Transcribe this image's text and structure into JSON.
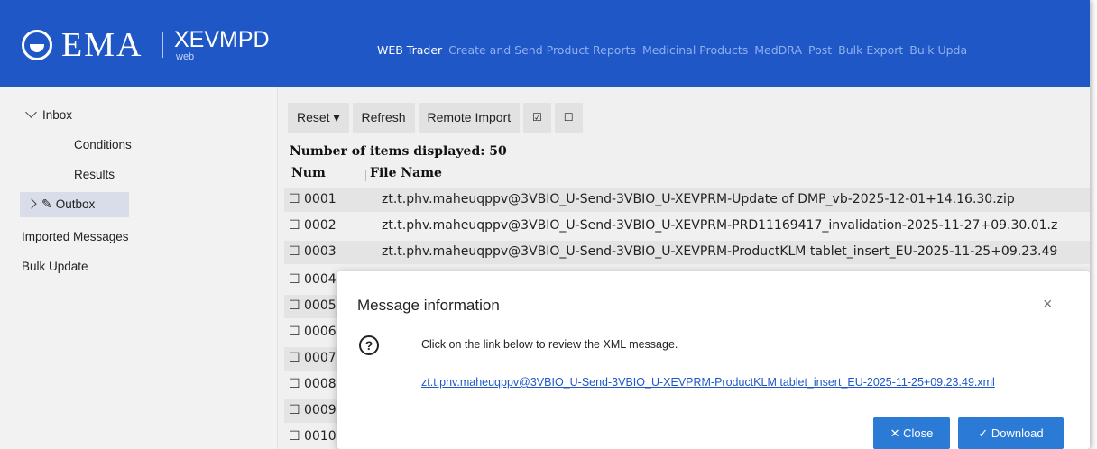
{
  "header": {
    "logo_text": "EMA",
    "app_name": "XEVMPD",
    "app_sub": "web",
    "nav": [
      {
        "label": "WEB Trader",
        "active": true
      },
      {
        "label": "Create and Send Product Reports"
      },
      {
        "label": "Medicinal Products"
      },
      {
        "label": "MedDRA"
      },
      {
        "label": "Post"
      },
      {
        "label": "Bulk Export"
      },
      {
        "label": "Bulk Upda"
      }
    ]
  },
  "sidebar": {
    "inbox_label": "Inbox",
    "conditions_label": "Conditions",
    "results_label": "Results",
    "outbox_label": "Outbox",
    "imported_label": "Imported Messages",
    "bulk_update_label": "Bulk Update"
  },
  "toolbar": {
    "reset_label": "Reset ▾",
    "refresh_label": "Refresh",
    "remote_import_label": "Remote Import",
    "check_all_label": "☑",
    "uncheck_all_label": "☐"
  },
  "list": {
    "count_label": "Number of items displayed: 50",
    "col_num": "Num",
    "col_file": "File Name",
    "rows": [
      {
        "num": "☐ 0001",
        "file": "zt.t.phv.maheuqppv@3VBIO_U-Send-3VBIO_U-XEVPRM-Update of DMP_vb-2025-12-01+14.16.30.zip"
      },
      {
        "num": "☐ 0002",
        "file": "zt.t.phv.maheuqppv@3VBIO_U-Send-3VBIO_U-XEVPRM-PRD11169417_invalidation-2025-11-27+09.30.01.z"
      },
      {
        "num": "☐ 0003",
        "file": "zt.t.phv.maheuqppv@3VBIO_U-Send-3VBIO_U-XEVPRM-ProductKLM tablet_insert_EU-2025-11-25+09.23.49"
      },
      {
        "num": "☐ 0004",
        "file": ""
      },
      {
        "num": "☐ 0005",
        "file": ""
      },
      {
        "num": "☐ 0006",
        "file": ""
      },
      {
        "num": "☐ 0007",
        "file": ""
      },
      {
        "num": "☐ 0008",
        "file": ""
      },
      {
        "num": "☐ 0009",
        "file": ""
      },
      {
        "num": "☐ 0010",
        "file": ""
      }
    ]
  },
  "modal": {
    "title": "Message information",
    "close_symbol": "×",
    "question_symbol": "?",
    "text": "Click on the link below to review the XML message.",
    "link": "zt.t.phv.maheuqppv@3VBIO_U-Send-3VBIO_U-XEVPRM-ProductKLM tablet_insert_EU-2025-11-25+09.23.49.xml",
    "close_button": "✕ Close",
    "download_button": "✓ Download"
  }
}
